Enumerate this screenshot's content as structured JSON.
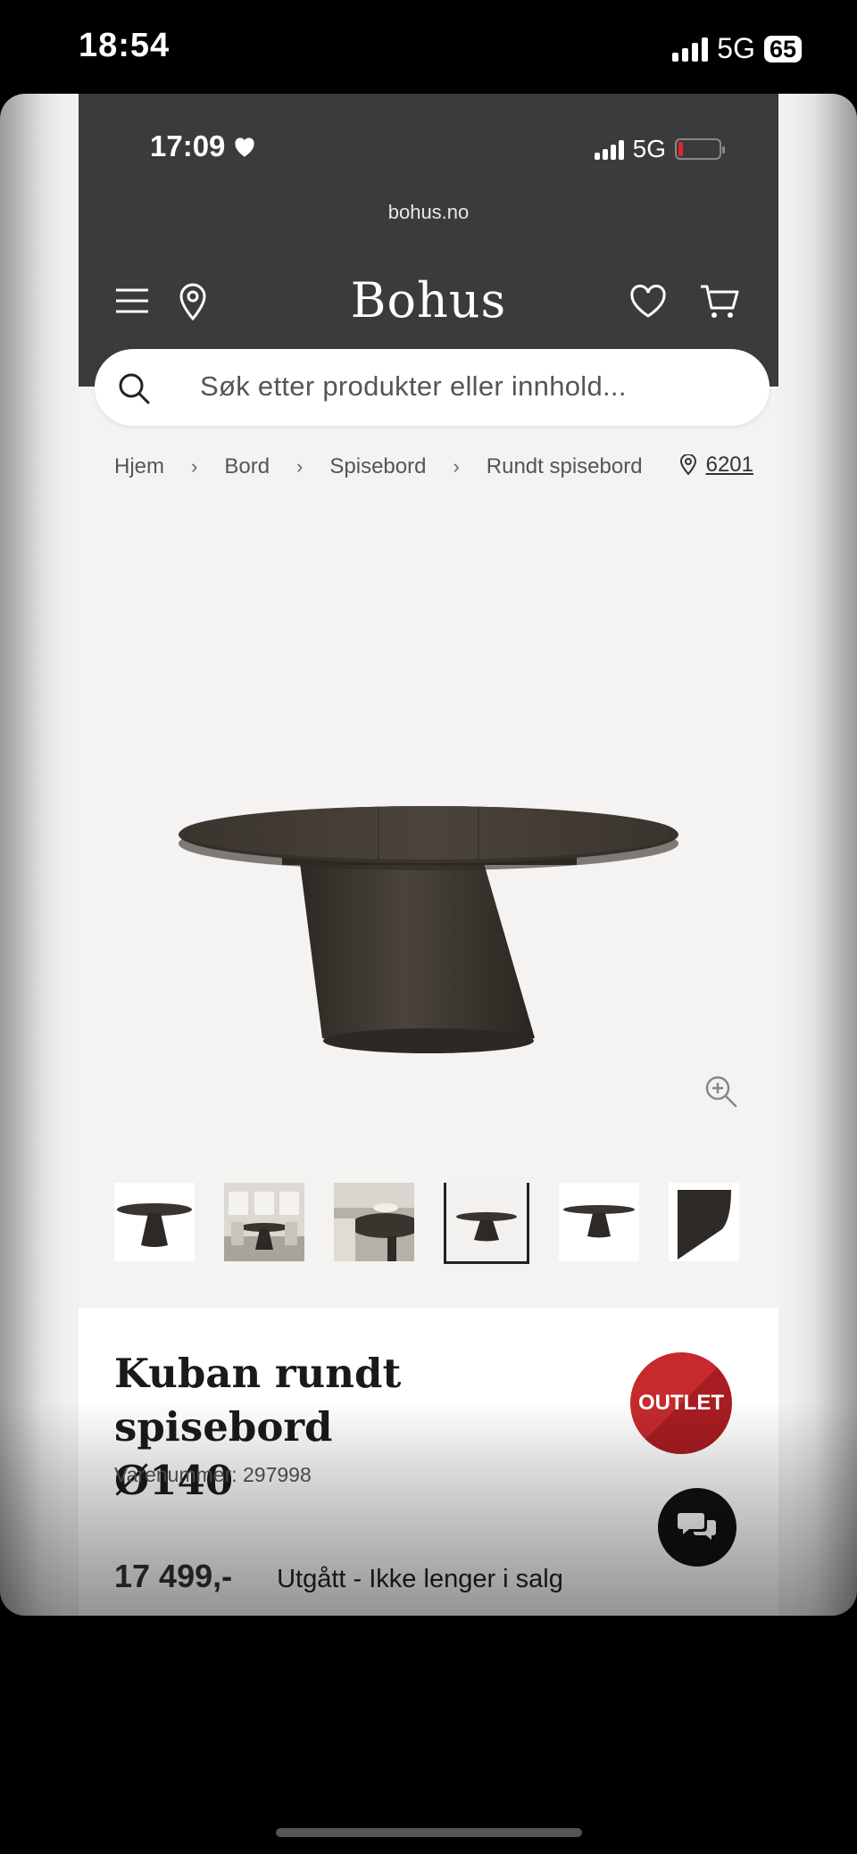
{
  "outer_status": {
    "time": "18:54",
    "network": "5G",
    "battery": "65"
  },
  "inner_status": {
    "time": "17:09",
    "network": "5G"
  },
  "browser": {
    "url": "bohus.no"
  },
  "header": {
    "logo": "Bohus"
  },
  "search": {
    "placeholder": "Søk etter produkter eller innhold..."
  },
  "breadcrumb": {
    "items": [
      "Hjem",
      "Bord",
      "Spisebord",
      "Rundt spisebord"
    ],
    "zip": "6201"
  },
  "product": {
    "title_line1": "Kuban rundt spisebord",
    "title_line2": "Ø140",
    "sku": "Varenummer: 297998",
    "badge": "OUTLET",
    "price": "17 499,-",
    "status": "Utgått - Ikke lenger i salg"
  },
  "icons": [
    "menu-icon",
    "location-pin-icon",
    "heart-icon",
    "cart-icon",
    "search-icon",
    "zoom-in-icon",
    "chat-icon"
  ],
  "colors": {
    "header_bg": "#3b3a3d",
    "page_bg": "#f4f3f1",
    "outlet_red": "#c62a2d",
    "table_wood": "#3a352f"
  }
}
